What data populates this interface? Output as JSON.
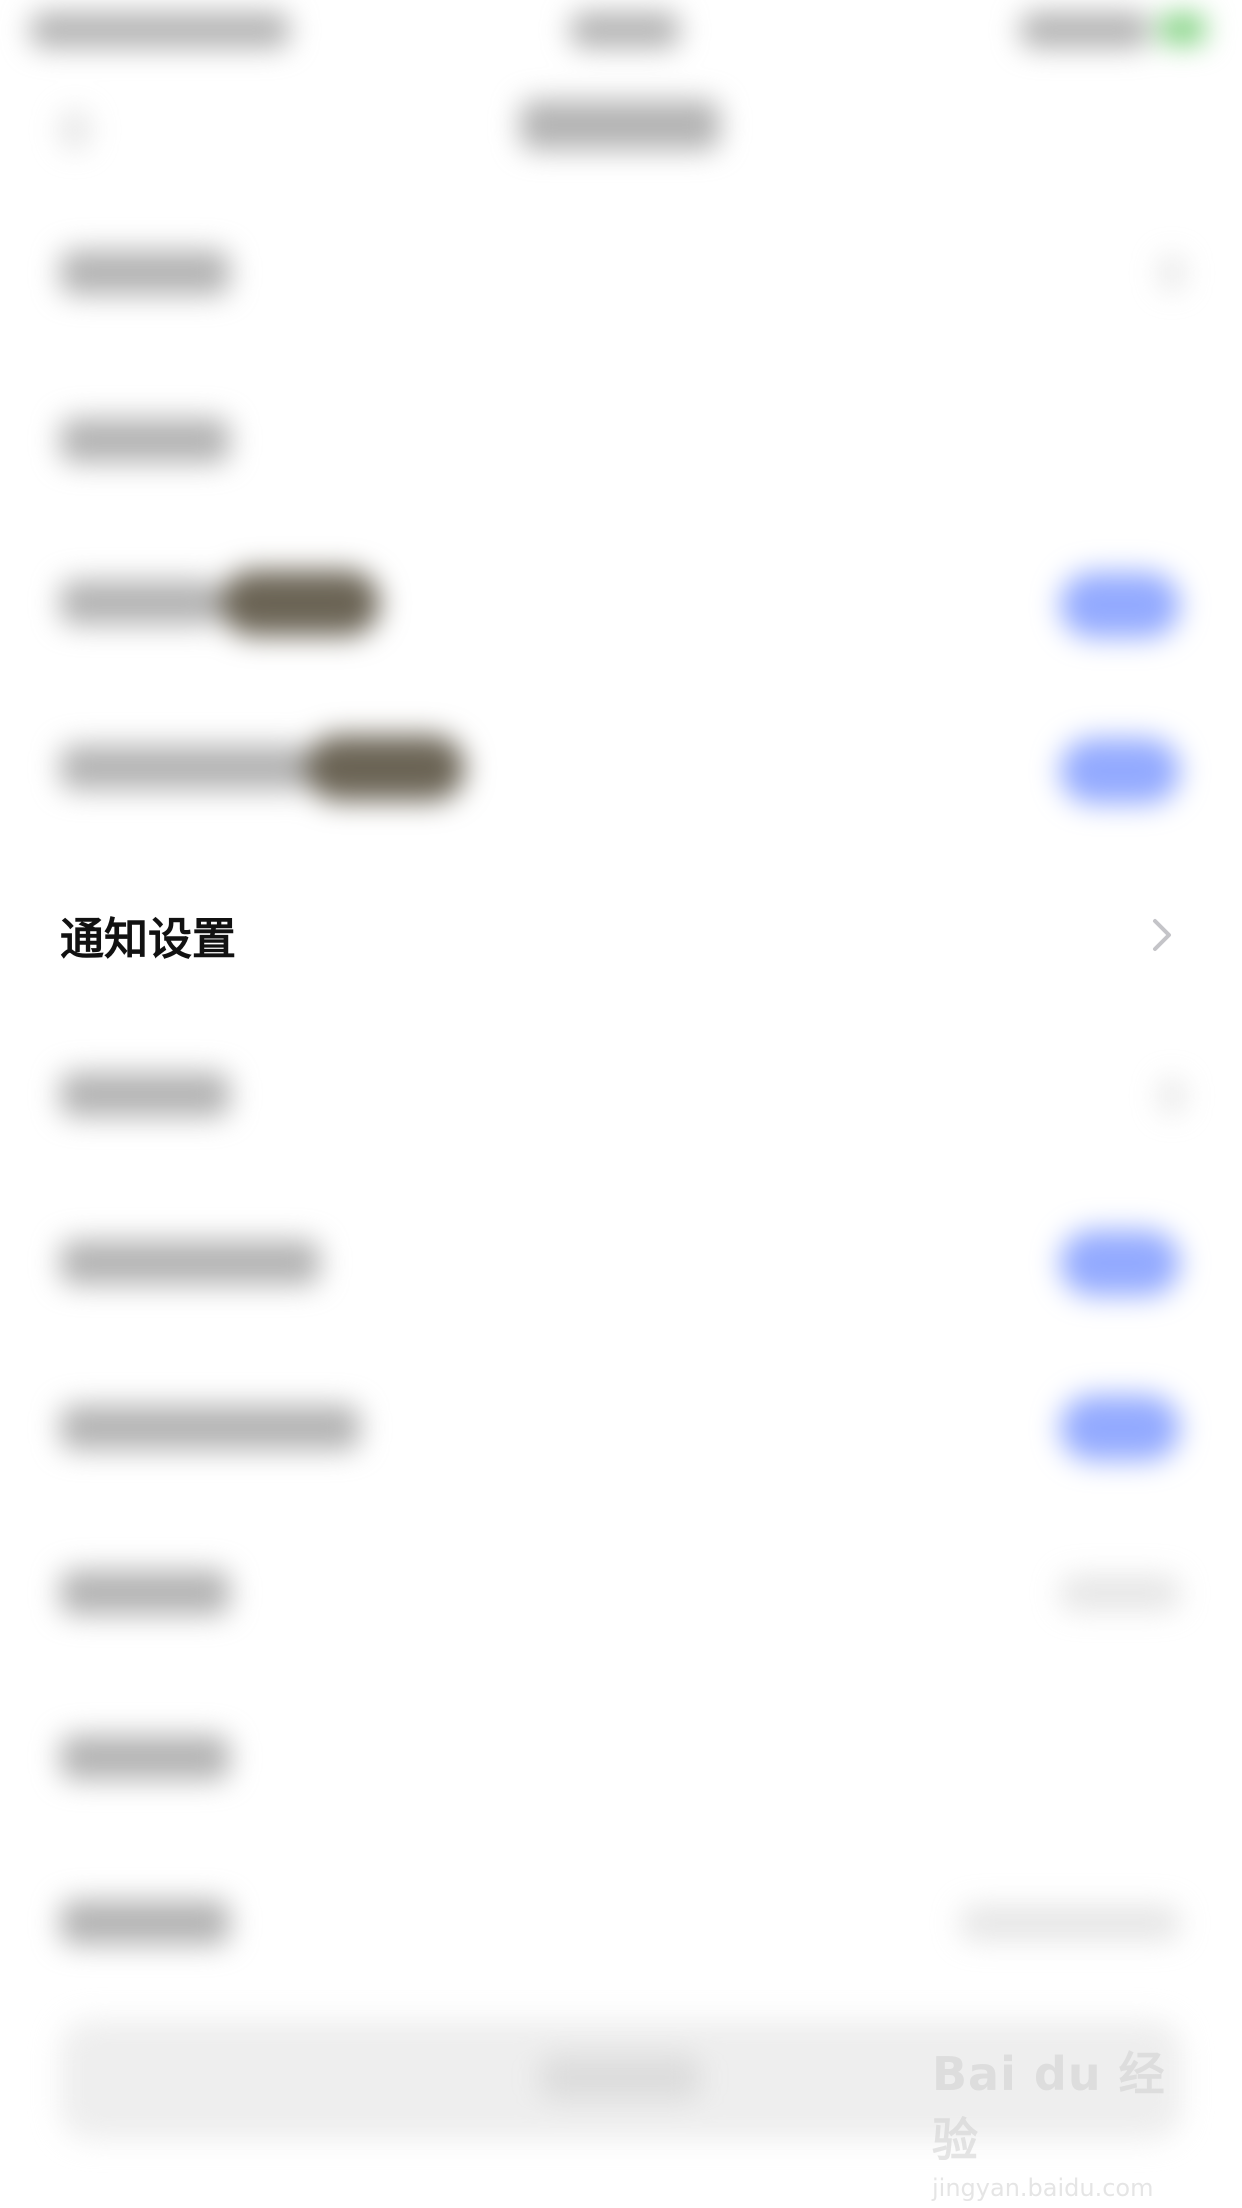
{
  "settings": {
    "visible_row": {
      "label": "通知设置",
      "icon": "chevron-right-icon"
    }
  },
  "watermark": {
    "brand": "Bai du 经验",
    "url": "jingyan.baidu.com"
  },
  "colors": {
    "toggle_accent": "#6f8dff",
    "label_text": "#111111",
    "chevron": "#c4c4c8"
  }
}
